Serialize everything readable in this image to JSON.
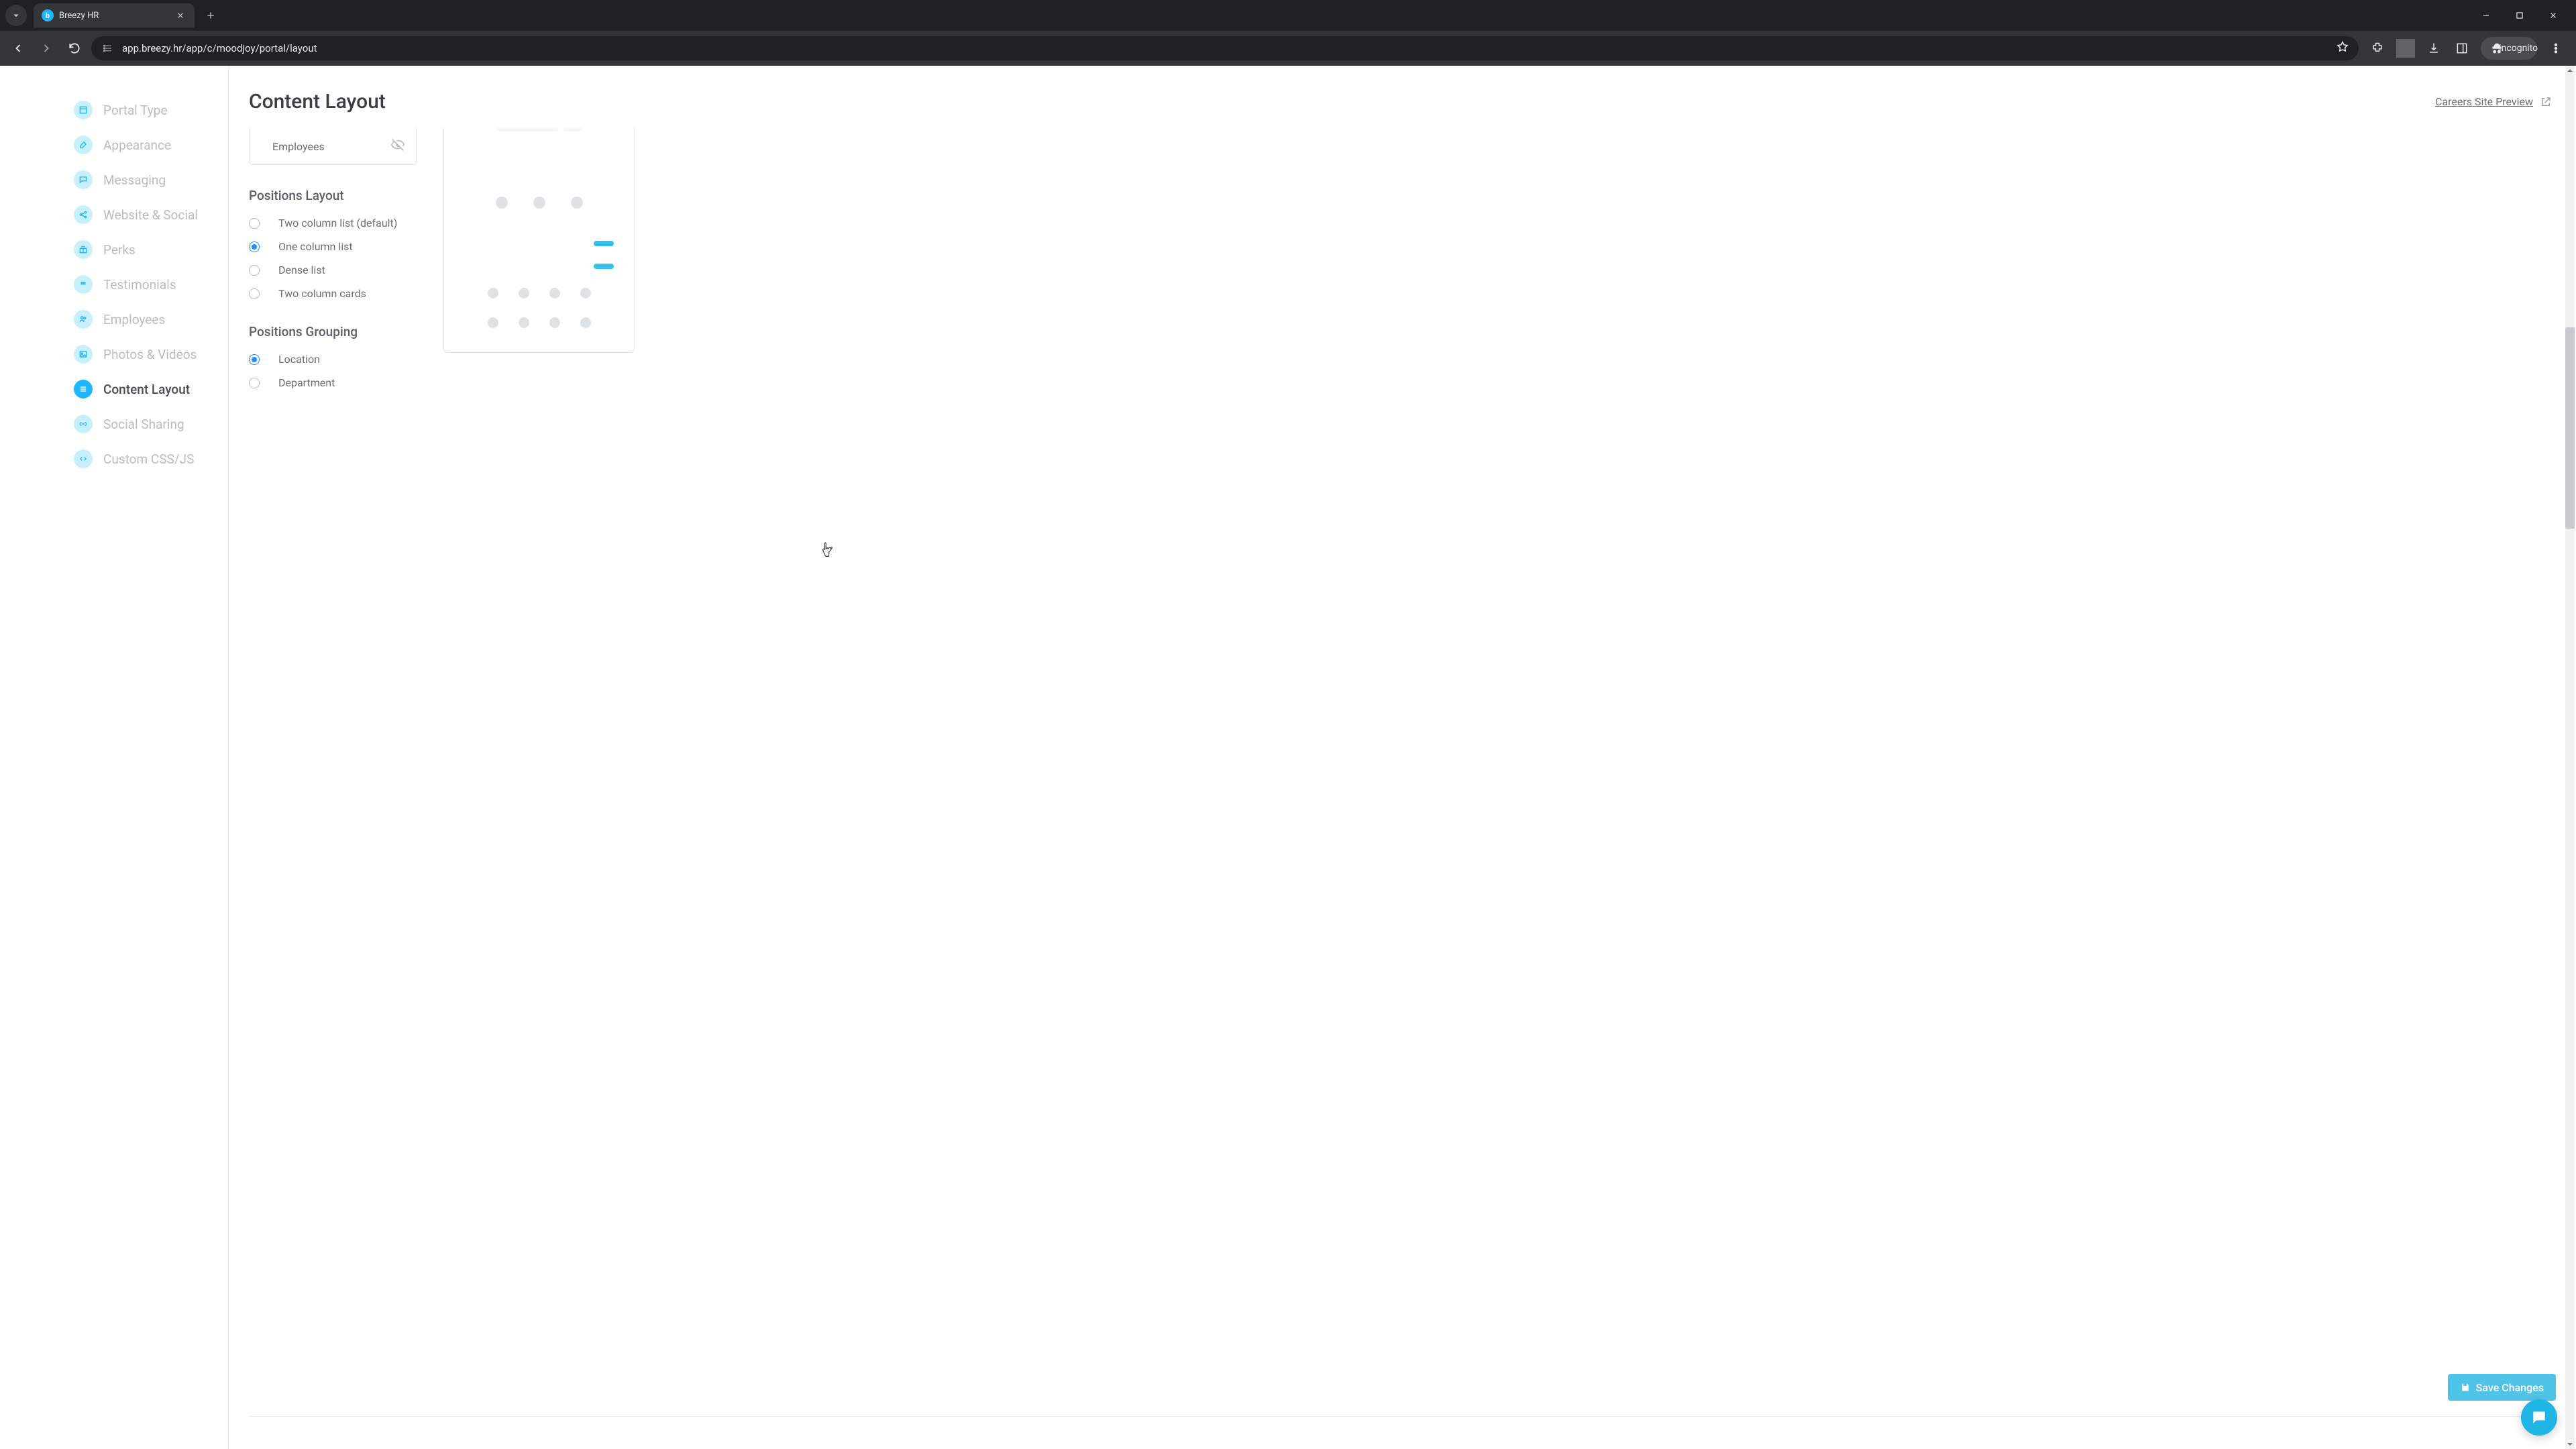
{
  "browser": {
    "tab_title": "Breezy HR",
    "url": "app.breezy.hr/app/c/moodjoy/portal/layout",
    "incognito_label": "Incognito"
  },
  "sidebar": {
    "items": [
      {
        "label": "Portal Type",
        "icon": "layout"
      },
      {
        "label": "Appearance",
        "icon": "paint"
      },
      {
        "label": "Messaging",
        "icon": "message"
      },
      {
        "label": "Website & Social",
        "icon": "share"
      },
      {
        "label": "Perks",
        "icon": "gift"
      },
      {
        "label": "Testimonials",
        "icon": "quote"
      },
      {
        "label": "Employees",
        "icon": "users"
      },
      {
        "label": "Photos & Videos",
        "icon": "image"
      },
      {
        "label": "Content Layout",
        "icon": "list"
      },
      {
        "label": "Social Sharing",
        "icon": "link"
      },
      {
        "label": "Custom CSS/JS",
        "icon": "code"
      }
    ],
    "active_index": 8
  },
  "main": {
    "title": "Content Layout",
    "preview_link": "Careers Site Preview",
    "employees_box_label": "Employees",
    "positions_layout": {
      "heading": "Positions Layout",
      "options": [
        "Two column list (default)",
        "One column list",
        "Dense list",
        "Two column cards"
      ],
      "selected_index": 1
    },
    "positions_grouping": {
      "heading": "Positions Grouping",
      "options": [
        "Location",
        "Department"
      ],
      "selected_index": 0
    },
    "save_button": "Save Changes"
  },
  "colors": {
    "accent": "#1fb6ff",
    "save_button": "#4fc3e8",
    "radio_checked": "#1f8fff"
  }
}
